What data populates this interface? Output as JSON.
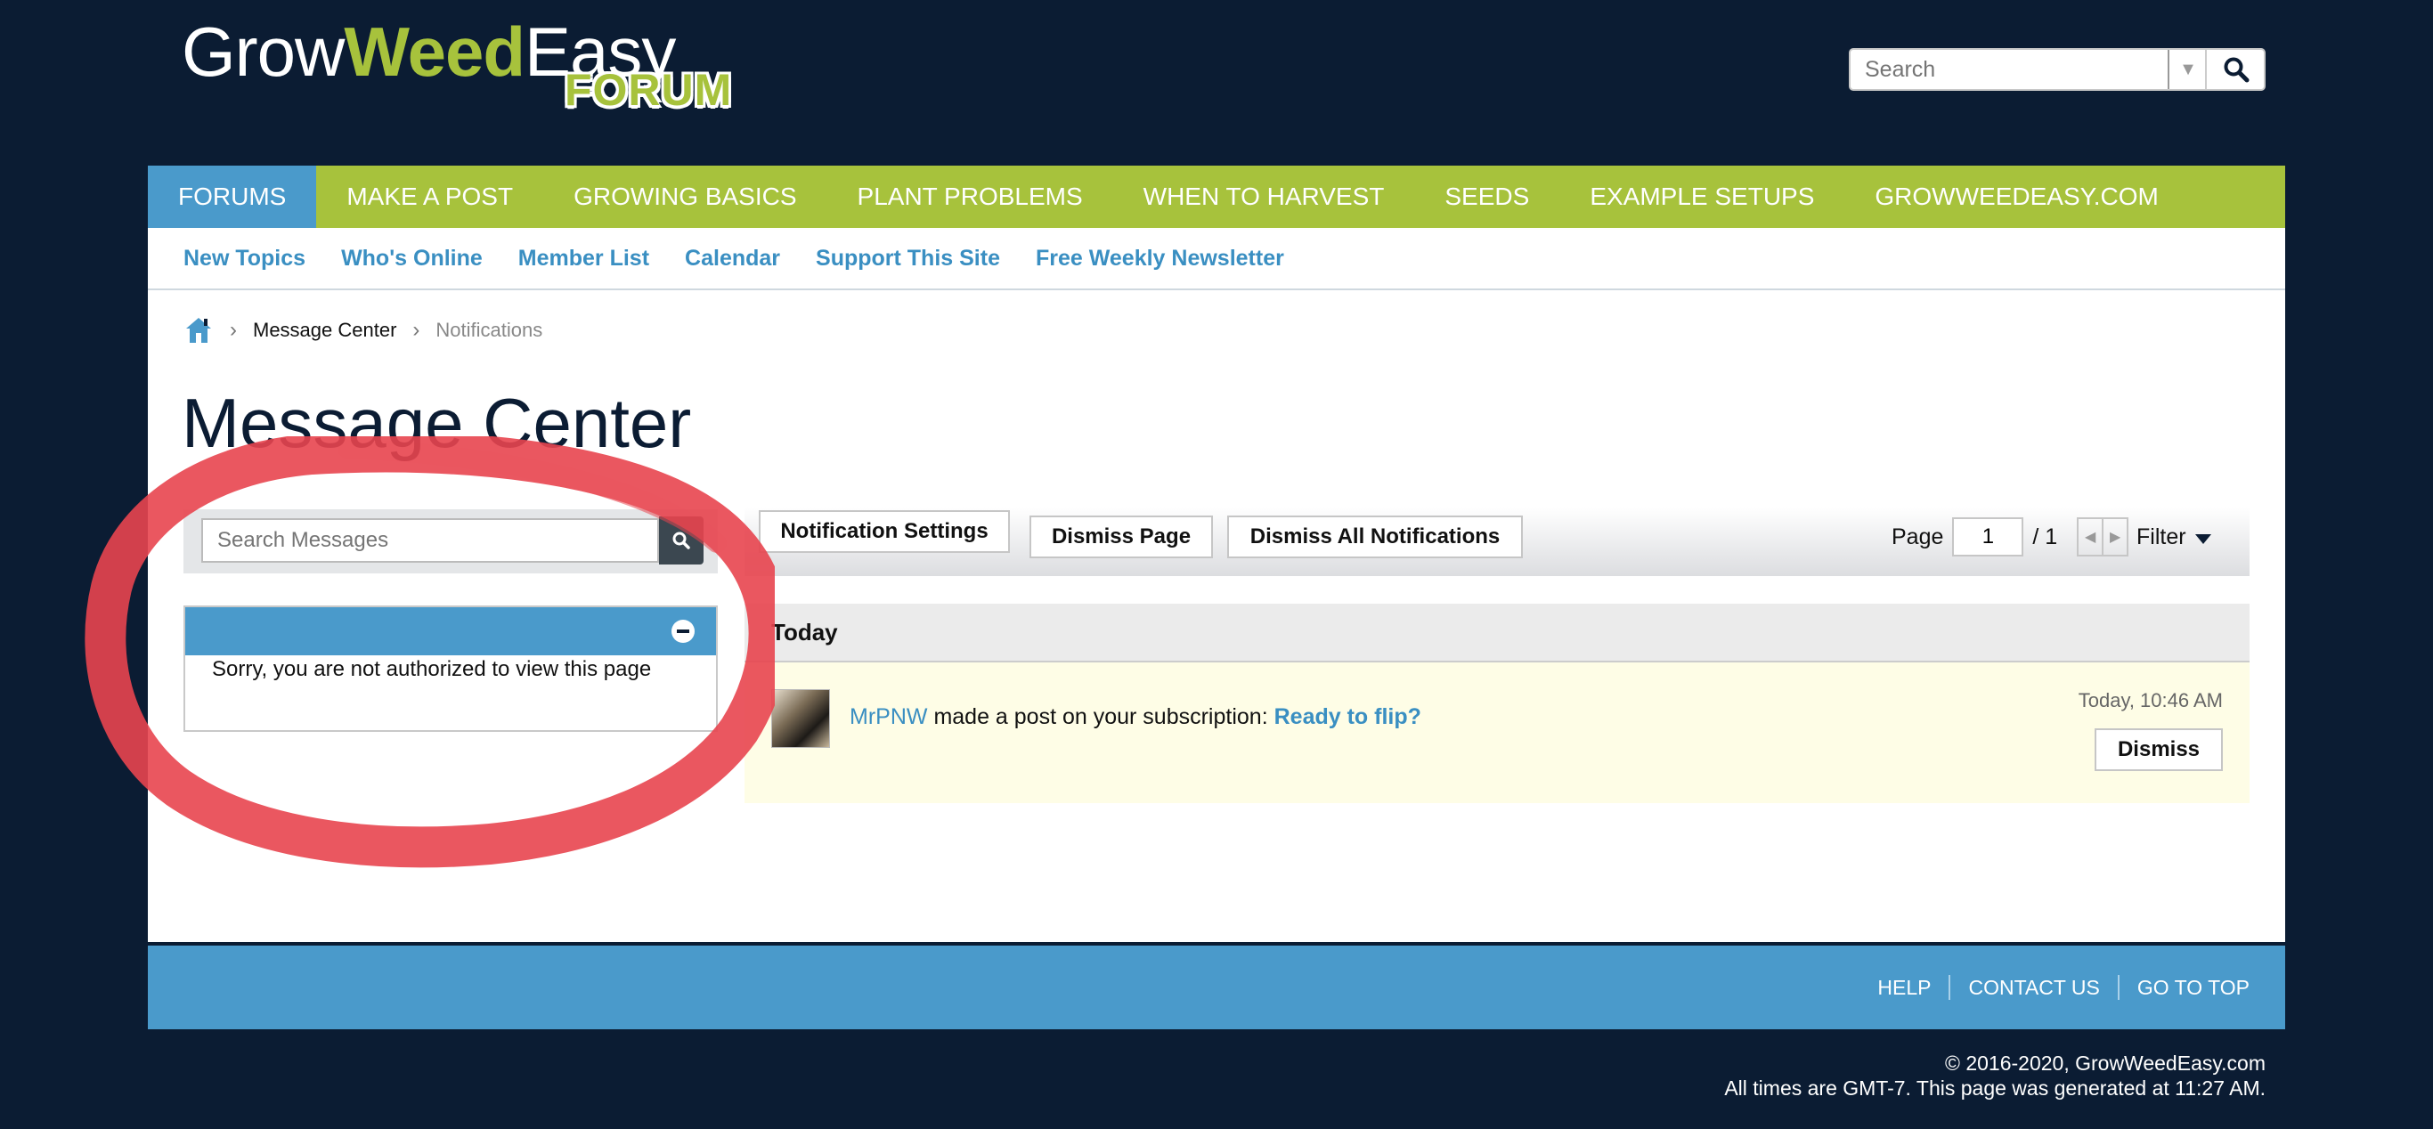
{
  "logo": {
    "grow": "Grow",
    "weed": "Weed",
    "easy": "Easy",
    "forum": "FORUM"
  },
  "header_search": {
    "placeholder": "Search"
  },
  "navbar": {
    "tabs": [
      {
        "label": "FORUMS"
      },
      {
        "label": "MAKE A POST"
      },
      {
        "label": "GROWING BASICS"
      },
      {
        "label": "PLANT PROBLEMS"
      },
      {
        "label": "WHEN TO HARVEST"
      },
      {
        "label": "SEEDS"
      },
      {
        "label": "EXAMPLE SETUPS"
      },
      {
        "label": "GROWWEEDEASY.COM"
      }
    ]
  },
  "subnav": {
    "links": [
      {
        "label": "New Topics"
      },
      {
        "label": "Who's Online"
      },
      {
        "label": "Member List"
      },
      {
        "label": "Calendar"
      },
      {
        "label": "Support This Site"
      },
      {
        "label": "Free Weekly Newsletter"
      }
    ]
  },
  "breadcrumb": {
    "items": [
      "Message Center",
      "Notifications"
    ]
  },
  "page_title": "Message Center",
  "sidebar": {
    "search_placeholder": "Search Messages",
    "panel_message": "Sorry, you are not authorized to view this page"
  },
  "toolbar": {
    "notification_settings": "Notification Settings",
    "dismiss_page": "Dismiss Page",
    "dismiss_all": "Dismiss All Notifications",
    "page_label": "Page",
    "page_value": "1",
    "page_total": "/ 1",
    "filter": "Filter"
  },
  "notifications": {
    "group_label": "Today",
    "items": [
      {
        "user": "MrPNW",
        "text": "made a post on your subscription:",
        "thread": "Ready to flip?",
        "time": "Today, 10:46 AM",
        "dismiss": "Dismiss"
      }
    ]
  },
  "footer": {
    "links": [
      "HELP",
      "CONTACT US",
      "GO TO TOP"
    ],
    "copyright": "© 2016-2020, GrowWeedEasy.com",
    "generated": "All times are GMT-7. This page was generated at 11:27 AM."
  },
  "colors": {
    "background": "#0b1c33",
    "nav_green": "#a7c23c",
    "accent_blue": "#4a9acb",
    "link_blue": "#3a8fc2",
    "notification_bg": "#fefde6",
    "annotation_red": "#e8454f"
  }
}
